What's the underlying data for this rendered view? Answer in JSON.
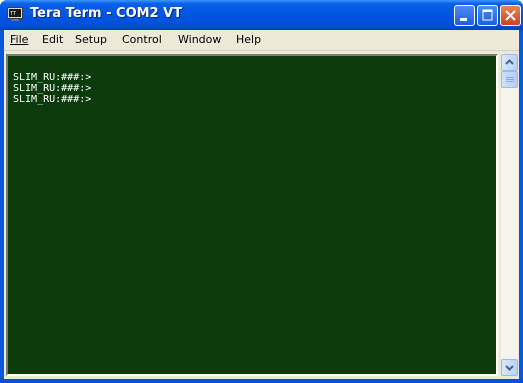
{
  "window": {
    "title": "Tera Term - COM2 VT",
    "icon": "teraterm-app-icon",
    "caption_buttons": [
      "minimize-icon",
      "maximize-icon",
      "close-icon"
    ],
    "colors": {
      "titlebar": "#0054e3",
      "terminal_bg": "#0b3b0b",
      "terminal_fg": "#ffffff",
      "menubar": "#ece9d8"
    }
  },
  "menu": [
    {
      "label": "File"
    },
    {
      "label": "Edit"
    },
    {
      "label": "Setup"
    },
    {
      "label": "Control"
    },
    {
      "label": "Window"
    },
    {
      "label": "Help"
    }
  ],
  "terminal": {
    "lines": [
      "SLIM_RU:###:>",
      "SLIM_RU:###:>",
      "SLIM_RU:###:>"
    ]
  },
  "scrollbar": {
    "icons": [
      "scroll-up-arrow-icon",
      "scroll-down-arrow-icon"
    ]
  }
}
